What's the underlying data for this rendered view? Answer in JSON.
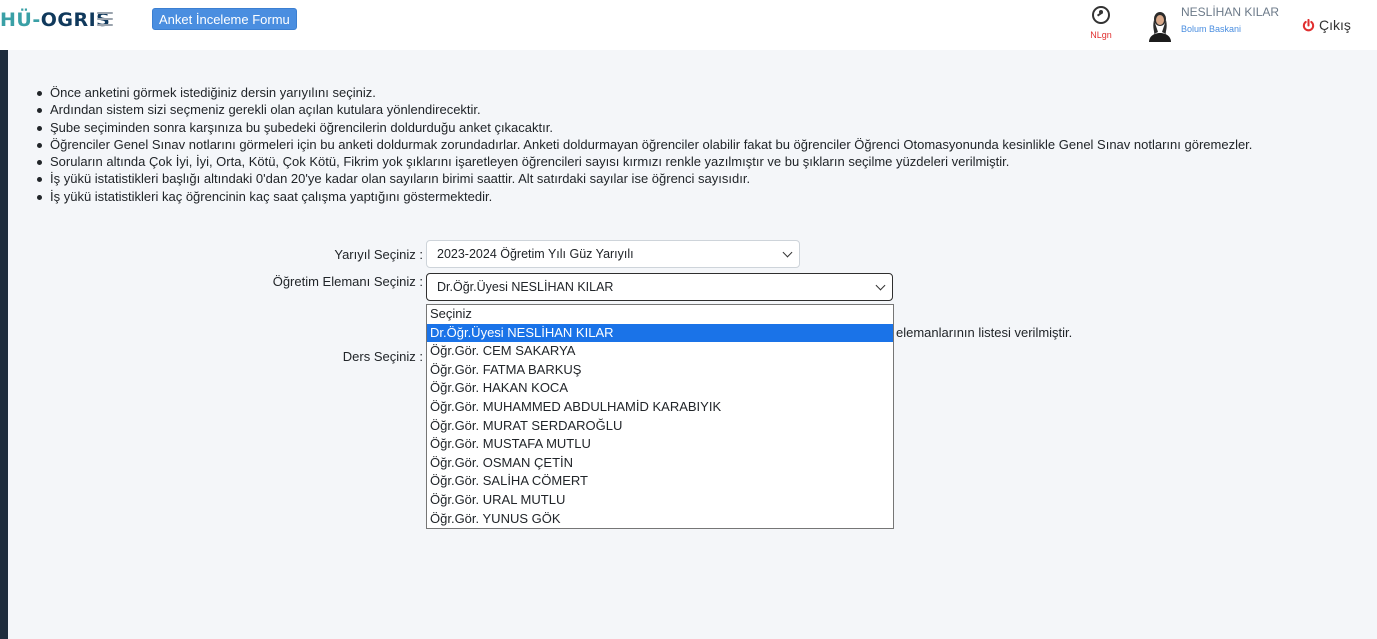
{
  "header": {
    "logo_prefix": "HÜ-",
    "logo_rest": "OGRIS",
    "form_badge": "Anket İnceleme Formu",
    "nlgn_label": "NLgn",
    "user_name": "NESLİHAN KILAR",
    "user_role": "Bolum Baskani",
    "logout_label": "Çıkış"
  },
  "instructions": [
    "Önce anketini görmek istediğiniz dersin yarıyılını seçiniz.",
    "Ardından sistem sizi seçmeniz gerekli olan açılan kutulara yönlendirecektir.",
    "Şube seçiminden  sonra karşınıza bu şubedeki öğrencilerin doldurduğu anket çıkacaktır.",
    "Öğrenciler Genel Sınav notlarını görmeleri için bu anketi doldurmak zorundadırlar. Anketi doldurmayan öğrenciler olabilir fakat bu öğrenciler Öğrenci Otomasyonunda kesinlikle Genel Sınav notlarını göremezler.",
    "Soruların altında Çok İyi, İyi, Orta, Kötü, Çok Kötü, Fikrim yok şıklarını işaretleyen öğrencileri sayısı kırmızı renkle yazılmıştır ve bu şıkların seçilme yüzdeleri verilmiştir.",
    "İş yükü istatistikleri başlığı altındaki 0'dan 20'ye kadar olan sayıların birimi saattir. Alt satırdaki sayılar ise öğrenci sayısıdır.",
    "İş yükü istatistikleri kaç öğrencinin kaç saat çalışma yaptığını göstermektedir."
  ],
  "form": {
    "semester_label": "Yarıyıl Seçiniz :",
    "semester_value": "2023-2024 Öğretim Yılı Güz Yarıyılı",
    "instructor_label": "Öğretim Elemanı Seçiniz :",
    "instructor_value": "Dr.Öğr.Üyesi NESLİHAN KILAR",
    "course_label": "Ders Seçiniz :",
    "note_tail": "elemanlarının listesi verilmiştir."
  },
  "dropdown": {
    "options": [
      "Seçiniz",
      "Dr.Öğr.Üyesi NESLİHAN KILAR",
      "Öğr.Gör. CEM SAKARYA",
      "Öğr.Gör. FATMA BARKUŞ",
      "Öğr.Gör. HAKAN KOCA",
      "Öğr.Gör. MUHAMMED ABDULHAMİD KARABIYIK",
      "Öğr.Gör. MURAT SERDAROĞLU",
      "Öğr.Gör. MUSTAFA MUTLU",
      "Öğr.Gör. OSMAN ÇETİN",
      "Öğr.Gör. SALİHA CÖMERT",
      "Öğr.Gör. URAL MUTLU",
      "Öğr.Gör. YUNUS GÖK"
    ],
    "selected_index": 1
  },
  "colors": {
    "accent": "#4a8ee0",
    "highlight": "#1a73e8",
    "logout_icon": "#e03030"
  }
}
